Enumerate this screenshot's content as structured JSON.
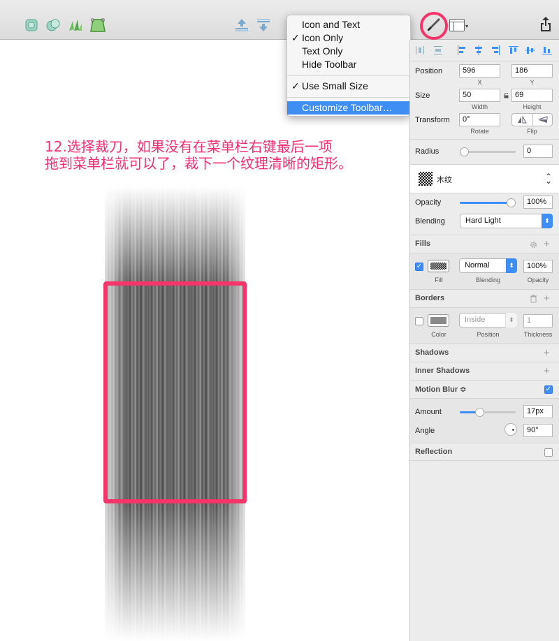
{
  "toolbar_menu": {
    "items": [
      {
        "label": "Icon and Text",
        "checked": false
      },
      {
        "label": "Icon Only",
        "checked": true
      },
      {
        "label": "Text Only",
        "checked": false
      },
      {
        "label": "Hide Toolbar",
        "checked": false
      },
      {
        "label": "Use Small Size",
        "checked": true
      },
      {
        "label": "Customize Toolbar…",
        "checked": false,
        "selected": true
      }
    ],
    "check_glyph": "✓"
  },
  "annotation": {
    "line1": "12.选择裁刀，如果没有在菜单栏右键最后一项",
    "line2": "拖到菜单栏就可以了，裁下一个纹理清晰的矩形。"
  },
  "inspector": {
    "position": {
      "label": "Position",
      "x": "596",
      "y": "186",
      "x_cap": "X",
      "y_cap": "Y"
    },
    "size": {
      "label": "Size",
      "width": "50",
      "height": "69",
      "w_cap": "Width",
      "h_cap": "Height"
    },
    "transform": {
      "label": "Transform",
      "rotate": "0°",
      "rotate_cap": "Rotate",
      "flip_cap": "Flip"
    },
    "radius": {
      "label": "Radius",
      "value": "0",
      "slider_fraction": 0
    },
    "style": {
      "name": "木纹"
    },
    "opacity": {
      "label": "Opacity",
      "value": "100%",
      "slider_fraction": 1.0
    },
    "blending": {
      "label": "Blending",
      "value": "Hard Light"
    },
    "fills": {
      "title": "Fills",
      "blend": "Normal",
      "opacity": "100%",
      "fill_cap": "Fill",
      "blend_cap": "Blending",
      "opacity_cap": "Opacity",
      "enabled": true
    },
    "borders": {
      "title": "Borders",
      "position": "Inside",
      "thickness": "1",
      "color_cap": "Color",
      "position_cap": "Position",
      "thickness_cap": "Thickness",
      "enabled": false
    },
    "shadows": {
      "title": "Shadows"
    },
    "inner_shadows": {
      "title": "Inner Shadows"
    },
    "motion_blur": {
      "title": "Motion Blur ≎",
      "enabled": true,
      "amount_label": "Amount",
      "amount": "17px",
      "amount_fraction": 0.33,
      "angle_label": "Angle",
      "angle": "90°"
    },
    "reflection": {
      "title": "Reflection",
      "enabled": false
    }
  },
  "colors": {
    "accent": "#3e8ef7",
    "highlight": "#f53469",
    "annotation_text": "#f22f75"
  }
}
